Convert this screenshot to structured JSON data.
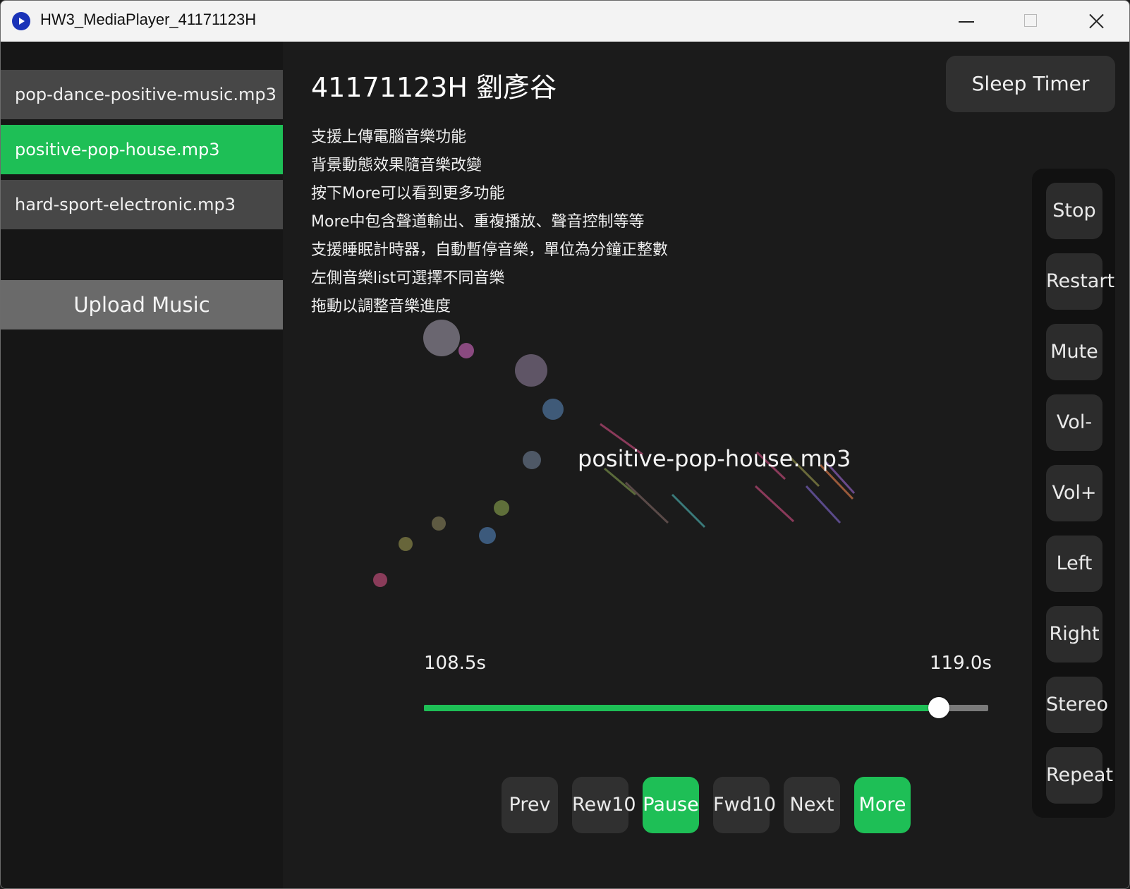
{
  "window": {
    "title": "HW3_MediaPlayer_41171123H"
  },
  "sidebar": {
    "tracks": [
      {
        "label": "pop-dance-positive-music.mp3",
        "selected": false
      },
      {
        "label": "positive-pop-house.mp3",
        "selected": true
      },
      {
        "label": "hard-sport-electronic.mp3",
        "selected": false
      }
    ],
    "upload_label": "Upload Music"
  },
  "main": {
    "heading": "41171123H 劉彥谷",
    "features": [
      "支援上傳電腦音樂功能",
      "背景動態效果隨音樂改變",
      "按下More可以看到更多功能",
      "More中包含聲道輸出、重複播放、聲音控制等等",
      "支援睡眠計時器，自動暫停音樂，單位為分鐘正整數",
      "左側音樂list可選擇不同音樂",
      "拖動以調整音樂進度"
    ],
    "sleep_timer_label": "Sleep Timer",
    "now_playing": "positive-pop-house.mp3",
    "progress": {
      "current_label": "108.5s",
      "total_label": "119.0s",
      "fraction": 0.912
    },
    "controls": [
      {
        "label": "Prev",
        "active": false
      },
      {
        "label": "Rew10",
        "active": false
      },
      {
        "label": "Pause",
        "active": true
      },
      {
        "label": "Fwd10",
        "active": false
      },
      {
        "label": "Next",
        "active": false
      },
      {
        "label": "More",
        "active": true
      }
    ],
    "side_buttons": [
      "Stop",
      "Restart",
      "Mute",
      "Vol-",
      "Vol+",
      "Left",
      "Right",
      "Stereo",
      "Repeat"
    ]
  },
  "colors": {
    "accent": "#1ebf56",
    "panel": "#303030",
    "background": "#1b1b1b"
  }
}
